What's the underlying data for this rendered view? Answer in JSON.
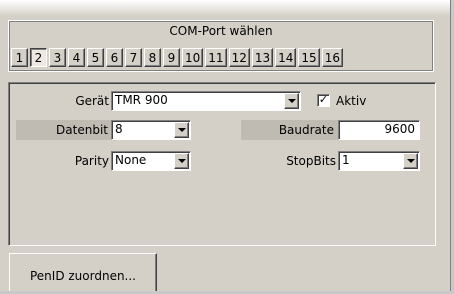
{
  "port_group": {
    "legend": "COM-Port wählen",
    "ports": [
      "1",
      "2",
      "3",
      "4",
      "5",
      "6",
      "7",
      "8",
      "9",
      "10",
      "11",
      "12",
      "13",
      "14",
      "15",
      "16"
    ],
    "selected": "2"
  },
  "settings": {
    "device_label": "Gerät",
    "device_value": "TMR 900",
    "active_label": "Aktiv",
    "active_checked": true,
    "check_mark": "✓",
    "databits_label": "Datenbit",
    "databits_value": "8",
    "baudrate_label": "Baudrate",
    "baudrate_value": "9600",
    "parity_label": "Parity",
    "parity_value": "None",
    "stopbits_label": "StopBits",
    "stopbits_value": "1"
  },
  "actions": {
    "assign_pen_label": "PenID zuordnen..."
  }
}
